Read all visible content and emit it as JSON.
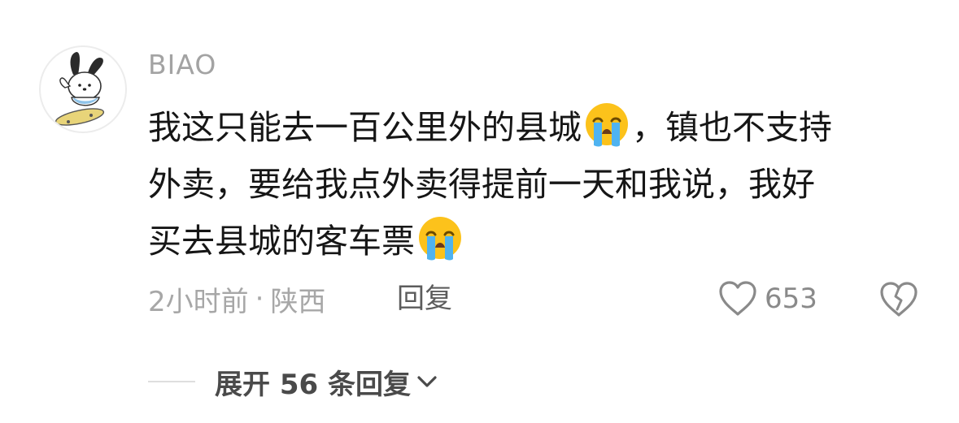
{
  "comment": {
    "username": "BIAO",
    "avatar_icon": "cartoon-dog-on-skateboard",
    "lines": [
      {
        "before": "我这只能去一百公里外的县城",
        "after": "，镇也不支持"
      },
      {
        "text": "外卖，要给我点外卖得提前一天和我说，我好"
      },
      {
        "before": "买去县城的客车票",
        "after": ""
      }
    ],
    "emoji": "loudly-crying-face",
    "time": "2小时前",
    "separator": "·",
    "location": "陕西",
    "reply_label": "回复",
    "like_count": "653"
  },
  "expand": {
    "label": "展开 56 条回复"
  },
  "colors": {
    "username": "#a3a3a3",
    "text": "#161616",
    "meta": "#a7a7a7",
    "reply": "#5c5c5c",
    "expand": "#4a4a4a"
  }
}
